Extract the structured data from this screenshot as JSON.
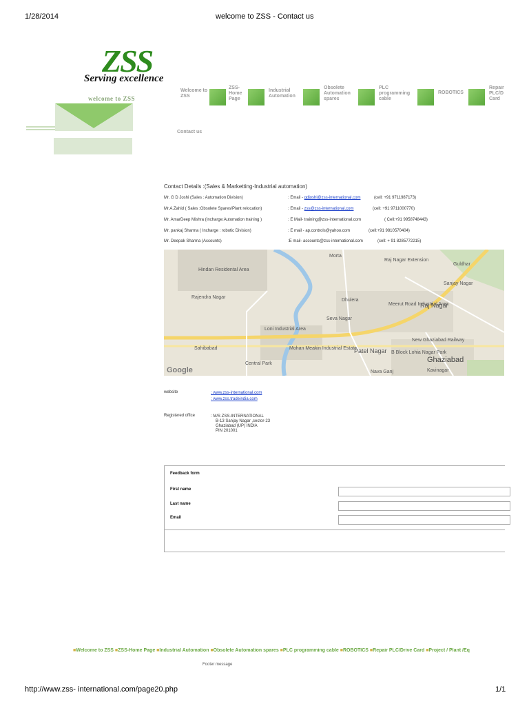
{
  "print_header": {
    "date": "1/28/2014",
    "title": "welcome to ZSS -  Contact us"
  },
  "logo": {
    "letters": "ZSS",
    "tagline": "Serving excellence"
  },
  "sidebar": {
    "welcome_text": "welcome to ZSS"
  },
  "nav": {
    "items": [
      {
        "label": "Welcome to ZSS"
      },
      {
        "label": "ZSS- Home Page"
      },
      {
        "label": "Industrial Automation"
      },
      {
        "label": "Obsolete Automation spares"
      },
      {
        "label": "PLC programming cable"
      },
      {
        "label": "ROBOTICS"
      },
      {
        "label": "Repair PLC/D Card"
      }
    ],
    "contact_label": "Contact us"
  },
  "contacts": {
    "title": "Contact Details :(Sales & Marketting-Industrial automation)",
    "rows": [
      {
        "name": "Mr. G D Joshi  (Sales : Automation Division)",
        "mail_prefix": ": Email - ",
        "mail": "gdjoshi@zss-international.com",
        "mail_is_link": true,
        "cell": "(cell: +91 9711987173)"
      },
      {
        "name": "Mr.A.Zahid  ( Sales :Obsolete Spares/Plant relocation)",
        "mail_prefix": ": Email - ",
        "mail": "zss@zss-international.com",
        "mail_is_link": true,
        "cell": "(cell: +91 9711000770)"
      },
      {
        "name": "Mr. AmarDeep Mishra (Incharge:Automation training )",
        "mail_prefix": ": E Mail-  ",
        "mail": "training@zss-international.com",
        "mail_is_link": false,
        "cell": "( Cell:+91 9958748443)"
      },
      {
        "name": "Mr. pankaj Sharma ( Incharge : robotic Division)",
        "mail_prefix": ": E mail - ",
        "mail": "ap.controls@yahoo.com",
        "mail_is_link": false,
        "cell": "(cell:+91 9810570404)"
      },
      {
        "name": "Mr. Deepak Sharma (Accounts)",
        "mail_prefix": ":E mail- ",
        "mail": "accounts@zss-international.com",
        "mail_is_link": false,
        "cell": "(cell: + 91 8285772215)"
      }
    ]
  },
  "map": {
    "labels": [
      {
        "text": "Hindan Residental Area"
      },
      {
        "text": "Rajendra Nagar"
      },
      {
        "text": "Loni Industrial Area"
      },
      {
        "text": "Sahibabad"
      },
      {
        "text": "Central Park"
      },
      {
        "text": "Mohan Meakin Industrial Estate"
      },
      {
        "text": "Seva Nagar"
      },
      {
        "text": "Patel Nagar"
      },
      {
        "text": "Raj Nagar"
      },
      {
        "text": "Raj Nagar Extension"
      },
      {
        "text": "Sanjay Nagar"
      },
      {
        "text": "Meerut Road Industrial Area"
      },
      {
        "text": "Ghaziabad"
      },
      {
        "text": "Kavinagar"
      },
      {
        "text": "Nava Ganj"
      },
      {
        "text": "Morta"
      },
      {
        "text": "Guldhar"
      },
      {
        "text": "New Ghaziabad Railway"
      },
      {
        "text": "B Block Lohia Nagar Park"
      },
      {
        "text": "Dhulera"
      }
    ],
    "google": "Google"
  },
  "info": {
    "website_label": "website",
    "websites": [
      ": www.zss-international.com",
      ": www.zss.tradeindia.com"
    ],
    "office_label": "Registered office",
    "office_lines": [
      ": M/S ZSS-INTERNATIONAL",
      "B-13 Sanjay Nagar ,sector-23",
      "Ghaziabad (UP) INDIA",
      "PIN 201001"
    ]
  },
  "form": {
    "title": "Feedback form",
    "first_name_label": "First name",
    "last_name_label": "Last name",
    "email_label": "Email",
    "first_name_value": "",
    "last_name_value": "",
    "email_value": ""
  },
  "footer": {
    "nav": [
      "Welcome to ZSS",
      "ZSS-Home Page",
      "Industrial Automation",
      "Obsolete Automation spares",
      "PLC programming cable",
      "ROBOTICS",
      "Repair PLC/Drive Card",
      "Project / Plant /Eq"
    ],
    "message": "Footer message"
  },
  "print_footer": {
    "url": "http://www.zss- international.com/page20.php",
    "page": "1/1"
  },
  "colors": {
    "brand_green": "#2e8b1e",
    "nav_green": "#6aa843",
    "link_blue": "#1a3ec9"
  }
}
